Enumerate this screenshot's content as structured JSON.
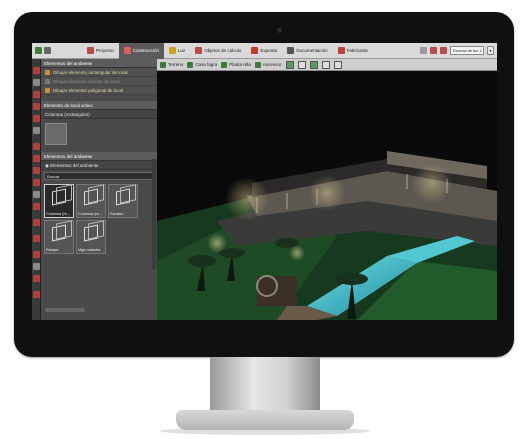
{
  "menu": {
    "tabs": [
      {
        "label": "Proyecto",
        "color": "#b94a4a"
      },
      {
        "label": "Construcción",
        "color": "#b94a4a",
        "active": true
      },
      {
        "label": "Luz",
        "color": "#d0a020"
      },
      {
        "label": "Objetos de cálculo",
        "color": "#b94a4a"
      },
      {
        "label": "Exportar",
        "color": "#c0392b"
      },
      {
        "label": "Documentación",
        "color": "#555555"
      },
      {
        "label": "Fabricante",
        "color": "#c04040"
      }
    ],
    "scene_select": "Escena de luz 1",
    "scene_button": "▾"
  },
  "panel": {
    "ambient_header": "Elementos del ambiente",
    "ambient_items": [
      {
        "label": "Dibujar elemento rectangular de local",
        "enabled": true
      },
      {
        "label": "Dibujar elemento circular de local",
        "enabled": false
      },
      {
        "label": "Dibujar elemento poligonal de local",
        "enabled": true
      }
    ],
    "active_header": "Elemento de local activo",
    "active_element": "Columna (rectangular)",
    "environment_header": "Elementos del ambiente",
    "environment_filter": "Elementos del ambiente",
    "search_label": "Buscar",
    "tiles": [
      {
        "label": "Columna (re...",
        "selected": true
      },
      {
        "label": "Columna (re...",
        "selected": false
      },
      {
        "label": "Escalón",
        "selected": false
      },
      {
        "label": "Rampa",
        "selected": false
      },
      {
        "label": "Viga maestra",
        "selected": false
      }
    ]
  },
  "viewport_tools": [
    {
      "label": "Terreno"
    },
    {
      "label": "Casa fagra"
    },
    {
      "label": "Planta Alta"
    },
    {
      "label": "Ascensor"
    }
  ],
  "colors": {
    "accent": "#b94a4a",
    "active_tab": "#5b5b5b",
    "pool": "#3fc0c8",
    "grass": "#1e5a2a"
  }
}
